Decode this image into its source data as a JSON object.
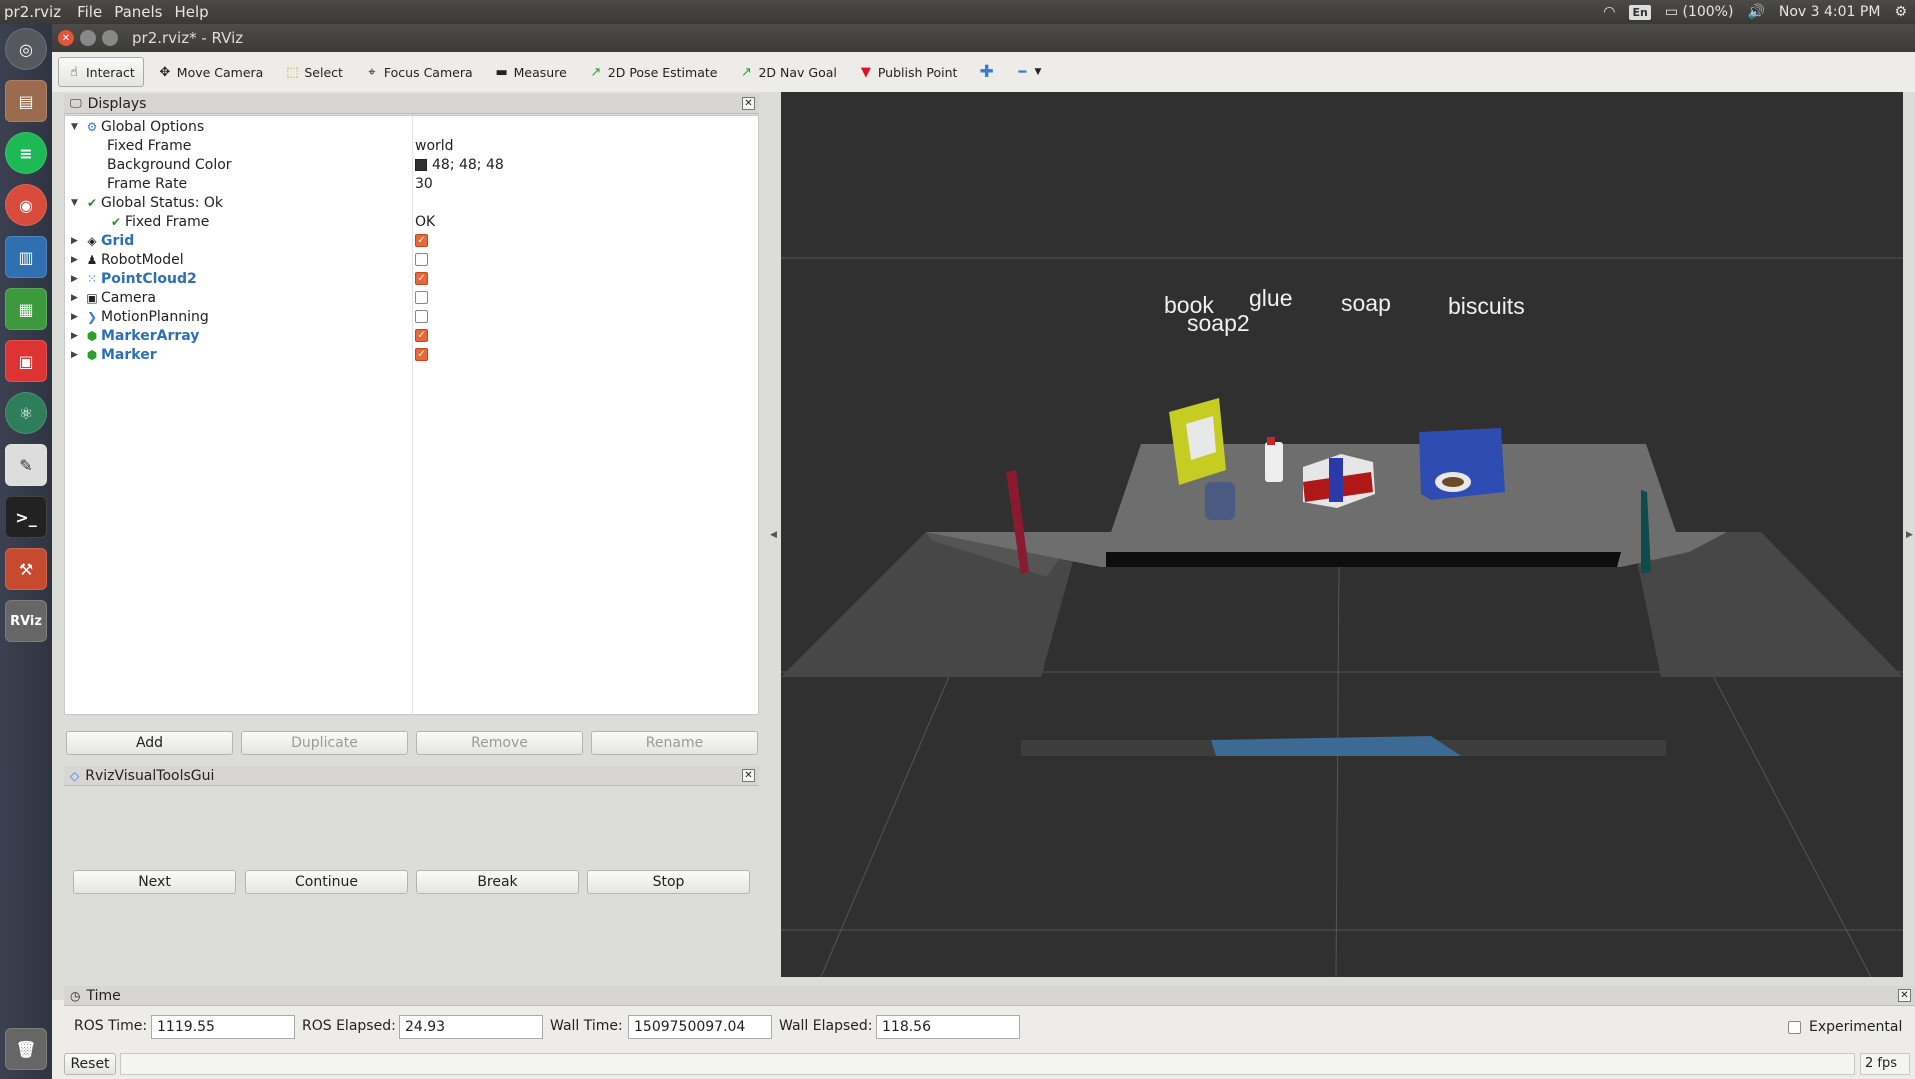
{
  "topbar": {
    "app": "pr2.rviz",
    "menus": [
      "File",
      "Panels",
      "Help"
    ],
    "lang": "En",
    "battery": "(100%)",
    "clock": "Nov 3  4:01 PM"
  },
  "window": {
    "title": "pr2.rviz* - RViz"
  },
  "toolbar": {
    "interact": "Interact",
    "move_camera": "Move Camera",
    "select": "Select",
    "focus_camera": "Focus Camera",
    "measure": "Measure",
    "pose_estimate": "2D Pose Estimate",
    "nav_goal": "2D Nav Goal",
    "publish_point": "Publish Point"
  },
  "displays": {
    "title": "Displays",
    "global_options": "Global Options",
    "fixed_frame": "Fixed Frame",
    "fixed_frame_val": "world",
    "bg_color": "Background Color",
    "bg_color_val": "48; 48; 48",
    "frame_rate": "Frame Rate",
    "frame_rate_val": "30",
    "global_status": "Global Status: Ok",
    "status_fixed_frame": "Fixed Frame",
    "status_fixed_frame_val": "OK",
    "items": [
      {
        "label": "Grid",
        "enabled": true
      },
      {
        "label": "RobotModel",
        "enabled": false
      },
      {
        "label": "PointCloud2",
        "enabled": true
      },
      {
        "label": "Camera",
        "enabled": false
      },
      {
        "label": "MotionPlanning",
        "enabled": false
      },
      {
        "label": "MarkerArray",
        "enabled": true
      },
      {
        "label": "Marker",
        "enabled": true
      }
    ],
    "buttons": {
      "add": "Add",
      "duplicate": "Duplicate",
      "remove": "Remove",
      "rename": "Rename"
    }
  },
  "rvt": {
    "title": "RvizVisualToolsGui",
    "next": "Next",
    "continue": "Continue",
    "break": "Break",
    "stop": "Stop"
  },
  "scene": {
    "labels": [
      "book",
      "glue",
      "soap",
      "biscuits",
      "soap2"
    ]
  },
  "time": {
    "title": "Time",
    "ros_time_label": "ROS Time:",
    "ros_time": "1119.55",
    "ros_elapsed_label": "ROS Elapsed:",
    "ros_elapsed": "24.93",
    "wall_time_label": "Wall Time:",
    "wall_time": "1509750097.04",
    "wall_elapsed_label": "Wall Elapsed:",
    "wall_elapsed": "118.56",
    "experimental": "Experimental",
    "reset": "Reset",
    "fps": "2 fps"
  }
}
